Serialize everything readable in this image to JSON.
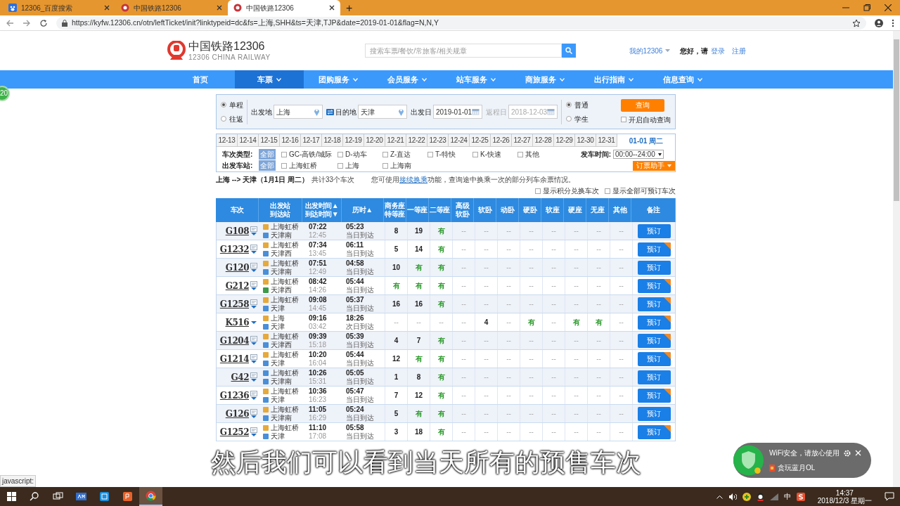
{
  "browser": {
    "tabs": [
      {
        "title": "12306_百度搜索",
        "kind": "baidu",
        "selected": false
      },
      {
        "title": "中国铁路12306",
        "kind": "railway",
        "selected": false
      },
      {
        "title": "中国铁路12306",
        "kind": "railway",
        "selected": true
      }
    ],
    "new_tab": "+",
    "url": "https://kyfw.12306.cn/otn/leftTicket/init?linktypeid=dc&fs=上海,SHH&ts=天津,TJP&date=2019-01-01&flag=N,N,Y"
  },
  "header": {
    "logo_title": "中国铁路12306",
    "logo_subtitle": "12306 CHINA RAILWAY",
    "search_placeholder": "搜索车票/餐饮/常旅客/相关规章",
    "my_account": "我的12306",
    "greeting": "您好，请",
    "login": "登录",
    "register": "注册"
  },
  "nav": [
    {
      "label": "首页",
      "dropdown": false,
      "selected": false
    },
    {
      "label": "车票",
      "dropdown": true,
      "selected": true
    },
    {
      "label": "团购服务",
      "dropdown": true,
      "selected": false
    },
    {
      "label": "会员服务",
      "dropdown": true,
      "selected": false
    },
    {
      "label": "站车服务",
      "dropdown": true,
      "selected": false
    },
    {
      "label": "商旅服务",
      "dropdown": true,
      "selected": false
    },
    {
      "label": "出行指南",
      "dropdown": true,
      "selected": false
    },
    {
      "label": "信息查询",
      "dropdown": true,
      "selected": false
    }
  ],
  "query": {
    "trip_types": [
      {
        "label": "单程",
        "selected": true
      },
      {
        "label": "往返",
        "selected": false
      }
    ],
    "from_label": "出发地",
    "from_value": "上海",
    "to_label": "目的地",
    "to_value": "天津",
    "date_label": "出发日",
    "date_value": "2019-01-01",
    "return_label": "返程日",
    "return_value": "2018-12-03",
    "passenger_types": [
      {
        "label": "普通",
        "selected": true
      },
      {
        "label": "学生",
        "selected": false
      }
    ],
    "search_button": "查询",
    "auto_query": {
      "label": "开启自动查询",
      "checked": false
    }
  },
  "dates": [
    {
      "label": "12-13",
      "selected": false
    },
    {
      "label": "12-14",
      "selected": false
    },
    {
      "label": "12-15",
      "selected": false
    },
    {
      "label": "12-16",
      "selected": false
    },
    {
      "label": "12-17",
      "selected": false
    },
    {
      "label": "12-18",
      "selected": false
    },
    {
      "label": "12-19",
      "selected": false
    },
    {
      "label": "12-20",
      "selected": false
    },
    {
      "label": "12-21",
      "selected": false
    },
    {
      "label": "12-22",
      "selected": false
    },
    {
      "label": "12-23",
      "selected": false
    },
    {
      "label": "12-24",
      "selected": false
    },
    {
      "label": "12-25",
      "selected": false
    },
    {
      "label": "12-26",
      "selected": false
    },
    {
      "label": "12-27",
      "selected": false
    },
    {
      "label": "12-28",
      "selected": false
    },
    {
      "label": "12-29",
      "selected": false
    },
    {
      "label": "12-30",
      "selected": false
    },
    {
      "label": "12-31",
      "selected": false
    },
    {
      "label": "01-01 周二",
      "selected": true
    }
  ],
  "filters": {
    "type_label": "车次类型:",
    "type_all": "全部",
    "types": [
      {
        "label": "GC-高铁/城际",
        "checked": false
      },
      {
        "label": "D-动车",
        "checked": false
      },
      {
        "label": "Z-直达",
        "checked": false
      },
      {
        "label": "T-特快",
        "checked": false
      },
      {
        "label": "K-快速",
        "checked": false
      },
      {
        "label": "其他",
        "checked": false
      }
    ],
    "station_label": "出发车站:",
    "station_all": "全部",
    "stations": [
      {
        "label": "上海虹桥",
        "checked": false
      },
      {
        "label": "上海",
        "checked": false
      },
      {
        "label": "上海南",
        "checked": false
      }
    ],
    "time_label": "发车时间:",
    "time_value": "00:00--24:00",
    "helper": "订票助手"
  },
  "summary": {
    "route": "上海 --> 天津（1月1日 周二）",
    "count": "共计33个车次",
    "tip_before": "您可使用",
    "tip_link": "接续换乘",
    "tip_after": "功能，查询途中换乘一次的部分列车余票情况。",
    "options": [
      {
        "label": "显示积分兑换车次",
        "checked": false
      },
      {
        "label": "显示全部可预订车次",
        "checked": false
      }
    ]
  },
  "columns": [
    [
      "车次"
    ],
    [
      "出发站",
      "到达站"
    ],
    [
      "出发时间▲",
      "到达时间▼"
    ],
    [
      "历时▲"
    ],
    [
      "商务座",
      "特等座"
    ],
    [
      "一等座"
    ],
    [
      "二等座"
    ],
    [
      "高级",
      "软卧"
    ],
    [
      "软卧"
    ],
    [
      "动卧"
    ],
    [
      "硬卧"
    ],
    [
      "软座"
    ],
    [
      "硬座"
    ],
    [
      "无座"
    ],
    [
      "其他"
    ],
    [
      "备注"
    ]
  ],
  "rows": [
    {
      "train": "G108",
      "info": true,
      "from": {
        "name": "上海虹桥",
        "color": "#e6a93c"
      },
      "to": {
        "name": "天津南",
        "color": "#4a8fd8"
      },
      "dep": "07:22",
      "arr": "12:45",
      "dur": "05:23",
      "note": "当日到达",
      "seats": [
        {
          "text": "8",
          "kind": "count"
        },
        {
          "text": "19",
          "kind": "count"
        },
        {
          "text": "有",
          "kind": "avail"
        },
        {
          "text": "--",
          "kind": "none"
        },
        {
          "text": "--",
          "kind": "none"
        },
        {
          "text": "--",
          "kind": "none"
        },
        {
          "text": "--",
          "kind": "none"
        },
        {
          "text": "--",
          "kind": "none"
        },
        {
          "text": "--",
          "kind": "none"
        },
        {
          "text": "--",
          "kind": "none"
        },
        {
          "text": "--",
          "kind": "none"
        }
      ],
      "book": "预订",
      "badge": false
    },
    {
      "train": "G1232",
      "info": true,
      "from": {
        "name": "上海虹桥",
        "color": "#e6a93c"
      },
      "to": {
        "name": "天津西",
        "color": "#4a8fd8"
      },
      "dep": "07:34",
      "arr": "13:45",
      "dur": "06:11",
      "note": "当日到达",
      "seats": [
        {
          "text": "5",
          "kind": "count"
        },
        {
          "text": "14",
          "kind": "count"
        },
        {
          "text": "有",
          "kind": "avail"
        },
        {
          "text": "--",
          "kind": "none"
        },
        {
          "text": "--",
          "kind": "none"
        },
        {
          "text": "--",
          "kind": "none"
        },
        {
          "text": "--",
          "kind": "none"
        },
        {
          "text": "--",
          "kind": "none"
        },
        {
          "text": "--",
          "kind": "none"
        },
        {
          "text": "--",
          "kind": "none"
        },
        {
          "text": "--",
          "kind": "none"
        }
      ],
      "book": "预订",
      "badge": true
    },
    {
      "train": "G120",
      "info": true,
      "from": {
        "name": "上海虹桥",
        "color": "#e6a93c"
      },
      "to": {
        "name": "天津南",
        "color": "#4a8fd8"
      },
      "dep": "07:51",
      "arr": "12:49",
      "dur": "04:58",
      "note": "当日到达",
      "seats": [
        {
          "text": "10",
          "kind": "count"
        },
        {
          "text": "有",
          "kind": "avail"
        },
        {
          "text": "有",
          "kind": "avail"
        },
        {
          "text": "--",
          "kind": "none"
        },
        {
          "text": "--",
          "kind": "none"
        },
        {
          "text": "--",
          "kind": "none"
        },
        {
          "text": "--",
          "kind": "none"
        },
        {
          "text": "--",
          "kind": "none"
        },
        {
          "text": "--",
          "kind": "none"
        },
        {
          "text": "--",
          "kind": "none"
        },
        {
          "text": "--",
          "kind": "none"
        }
      ],
      "book": "预订",
      "badge": false
    },
    {
      "train": "G212",
      "info": true,
      "from": {
        "name": "上海虹桥",
        "color": "#e6a93c"
      },
      "to": {
        "name": "天津西",
        "color": "#3e9a4a"
      },
      "dep": "08:42",
      "arr": "14:26",
      "dur": "05:44",
      "note": "当日到达",
      "seats": [
        {
          "text": "有",
          "kind": "avail"
        },
        {
          "text": "有",
          "kind": "avail"
        },
        {
          "text": "有",
          "kind": "avail"
        },
        {
          "text": "--",
          "kind": "none"
        },
        {
          "text": "--",
          "kind": "none"
        },
        {
          "text": "--",
          "kind": "none"
        },
        {
          "text": "--",
          "kind": "none"
        },
        {
          "text": "--",
          "kind": "none"
        },
        {
          "text": "--",
          "kind": "none"
        },
        {
          "text": "--",
          "kind": "none"
        },
        {
          "text": "--",
          "kind": "none"
        }
      ],
      "book": "预订",
      "badge": true
    },
    {
      "train": "G1258",
      "info": true,
      "from": {
        "name": "上海虹桥",
        "color": "#e6a93c"
      },
      "to": {
        "name": "天津",
        "color": "#4a8fd8"
      },
      "dep": "09:08",
      "arr": "14:45",
      "dur": "05:37",
      "note": "当日到达",
      "seats": [
        {
          "text": "16",
          "kind": "count"
        },
        {
          "text": "16",
          "kind": "count"
        },
        {
          "text": "有",
          "kind": "avail"
        },
        {
          "text": "--",
          "kind": "none"
        },
        {
          "text": "--",
          "kind": "none"
        },
        {
          "text": "--",
          "kind": "none"
        },
        {
          "text": "--",
          "kind": "none"
        },
        {
          "text": "--",
          "kind": "none"
        },
        {
          "text": "--",
          "kind": "none"
        },
        {
          "text": "--",
          "kind": "none"
        },
        {
          "text": "--",
          "kind": "none"
        }
      ],
      "book": "预订",
      "badge": true
    },
    {
      "train": "K516",
      "info": false,
      "from": {
        "name": "上海",
        "color": "#e6a93c"
      },
      "to": {
        "name": "天津",
        "color": "#4a8fd8"
      },
      "dep": "09:16",
      "arr": "03:42",
      "dur": "18:26",
      "note": "次日到达",
      "seats": [
        {
          "text": "--",
          "kind": "none"
        },
        {
          "text": "--",
          "kind": "none"
        },
        {
          "text": "--",
          "kind": "none"
        },
        {
          "text": "--",
          "kind": "none"
        },
        {
          "text": "4",
          "kind": "count"
        },
        {
          "text": "--",
          "kind": "none"
        },
        {
          "text": "有",
          "kind": "avail"
        },
        {
          "text": "--",
          "kind": "none"
        },
        {
          "text": "有",
          "kind": "avail"
        },
        {
          "text": "有",
          "kind": "avail"
        },
        {
          "text": "--",
          "kind": "none"
        }
      ],
      "book": "预订",
      "badge": true
    },
    {
      "train": "G1204",
      "info": true,
      "from": {
        "name": "上海虹桥",
        "color": "#e6a93c"
      },
      "to": {
        "name": "天津西",
        "color": "#4a8fd8"
      },
      "dep": "09:39",
      "arr": "15:18",
      "dur": "05:39",
      "note": "当日到达",
      "seats": [
        {
          "text": "4",
          "kind": "count"
        },
        {
          "text": "7",
          "kind": "count"
        },
        {
          "text": "有",
          "kind": "avail"
        },
        {
          "text": "--",
          "kind": "none"
        },
        {
          "text": "--",
          "kind": "none"
        },
        {
          "text": "--",
          "kind": "none"
        },
        {
          "text": "--",
          "kind": "none"
        },
        {
          "text": "--",
          "kind": "none"
        },
        {
          "text": "--",
          "kind": "none"
        },
        {
          "text": "--",
          "kind": "none"
        },
        {
          "text": "--",
          "kind": "none"
        }
      ],
      "book": "预订",
      "badge": true
    },
    {
      "train": "G1214",
      "info": true,
      "from": {
        "name": "上海虹桥",
        "color": "#e6a93c"
      },
      "to": {
        "name": "天津",
        "color": "#4a8fd8"
      },
      "dep": "10:20",
      "arr": "16:04",
      "dur": "05:44",
      "note": "当日到达",
      "seats": [
        {
          "text": "12",
          "kind": "count"
        },
        {
          "text": "有",
          "kind": "avail"
        },
        {
          "text": "有",
          "kind": "avail"
        },
        {
          "text": "--",
          "kind": "none"
        },
        {
          "text": "--",
          "kind": "none"
        },
        {
          "text": "--",
          "kind": "none"
        },
        {
          "text": "--",
          "kind": "none"
        },
        {
          "text": "--",
          "kind": "none"
        },
        {
          "text": "--",
          "kind": "none"
        },
        {
          "text": "--",
          "kind": "none"
        },
        {
          "text": "--",
          "kind": "none"
        }
      ],
      "book": "预订",
      "badge": true
    },
    {
      "train": "G42",
      "info": true,
      "from": {
        "name": "上海虹桥",
        "color": "#4a8fd8"
      },
      "to": {
        "name": "天津南",
        "color": "#4a8fd8"
      },
      "dep": "10:26",
      "arr": "15:31",
      "dur": "05:05",
      "note": "当日到达",
      "seats": [
        {
          "text": "1",
          "kind": "count"
        },
        {
          "text": "8",
          "kind": "count"
        },
        {
          "text": "有",
          "kind": "avail"
        },
        {
          "text": "--",
          "kind": "none"
        },
        {
          "text": "--",
          "kind": "none"
        },
        {
          "text": "--",
          "kind": "none"
        },
        {
          "text": "--",
          "kind": "none"
        },
        {
          "text": "--",
          "kind": "none"
        },
        {
          "text": "--",
          "kind": "none"
        },
        {
          "text": "--",
          "kind": "none"
        },
        {
          "text": "--",
          "kind": "none"
        }
      ],
      "book": "预订",
      "badge": false
    },
    {
      "train": "G1236",
      "info": true,
      "from": {
        "name": "上海虹桥",
        "color": "#e6a93c"
      },
      "to": {
        "name": "天津",
        "color": "#4a8fd8"
      },
      "dep": "10:36",
      "arr": "16:23",
      "dur": "05:47",
      "note": "当日到达",
      "seats": [
        {
          "text": "7",
          "kind": "count"
        },
        {
          "text": "12",
          "kind": "count"
        },
        {
          "text": "有",
          "kind": "avail"
        },
        {
          "text": "--",
          "kind": "none"
        },
        {
          "text": "--",
          "kind": "none"
        },
        {
          "text": "--",
          "kind": "none"
        },
        {
          "text": "--",
          "kind": "none"
        },
        {
          "text": "--",
          "kind": "none"
        },
        {
          "text": "--",
          "kind": "none"
        },
        {
          "text": "--",
          "kind": "none"
        },
        {
          "text": "--",
          "kind": "none"
        }
      ],
      "book": "预订",
      "badge": true
    },
    {
      "train": "G126",
      "info": true,
      "from": {
        "name": "上海虹桥",
        "color": "#e6a93c"
      },
      "to": {
        "name": "天津南",
        "color": "#4a8fd8"
      },
      "dep": "11:05",
      "arr": "16:29",
      "dur": "05:24",
      "note": "当日到达",
      "seats": [
        {
          "text": "5",
          "kind": "count"
        },
        {
          "text": "有",
          "kind": "avail"
        },
        {
          "text": "有",
          "kind": "avail"
        },
        {
          "text": "--",
          "kind": "none"
        },
        {
          "text": "--",
          "kind": "none"
        },
        {
          "text": "--",
          "kind": "none"
        },
        {
          "text": "--",
          "kind": "none"
        },
        {
          "text": "--",
          "kind": "none"
        },
        {
          "text": "--",
          "kind": "none"
        },
        {
          "text": "--",
          "kind": "none"
        },
        {
          "text": "--",
          "kind": "none"
        }
      ],
      "book": "预订",
      "badge": false
    },
    {
      "train": "G1252",
      "info": true,
      "from": {
        "name": "上海虹桥",
        "color": "#e6a93c"
      },
      "to": {
        "name": "天津",
        "color": "#4a8fd8"
      },
      "dep": "11:10",
      "arr": "17:08",
      "dur": "05:58",
      "note": "当日到达",
      "seats": [
        {
          "text": "3",
          "kind": "count"
        },
        {
          "text": "18",
          "kind": "count"
        },
        {
          "text": "有",
          "kind": "avail"
        },
        {
          "text": "--",
          "kind": "none"
        },
        {
          "text": "--",
          "kind": "none"
        },
        {
          "text": "--",
          "kind": "none"
        },
        {
          "text": "--",
          "kind": "none"
        },
        {
          "text": "--",
          "kind": "none"
        },
        {
          "text": "--",
          "kind": "none"
        },
        {
          "text": "--",
          "kind": "none"
        },
        {
          "text": "--",
          "kind": "none"
        }
      ],
      "book": "预订",
      "badge": true
    }
  ],
  "subtitle": "然后我们可以看到当天所有的预售车次",
  "popup": {
    "message": "WiFi安全，请放心使用",
    "app": "贪玩蓝月OL"
  },
  "status_text": "javascript:",
  "side_badge": "20",
  "taskbar": {
    "apps": [
      {
        "kind": "windows",
        "selected": false
      },
      {
        "kind": "search",
        "selected": false
      },
      {
        "kind": "taskview",
        "selected": false
      },
      {
        "kind": "am",
        "selected": false
      },
      {
        "kind": "blue",
        "selected": false
      },
      {
        "kind": "orange",
        "selected": false
      },
      {
        "kind": "chrome",
        "selected": true
      }
    ],
    "ime": "中",
    "time": "14:37",
    "date": "2018/12/3 星期一"
  }
}
